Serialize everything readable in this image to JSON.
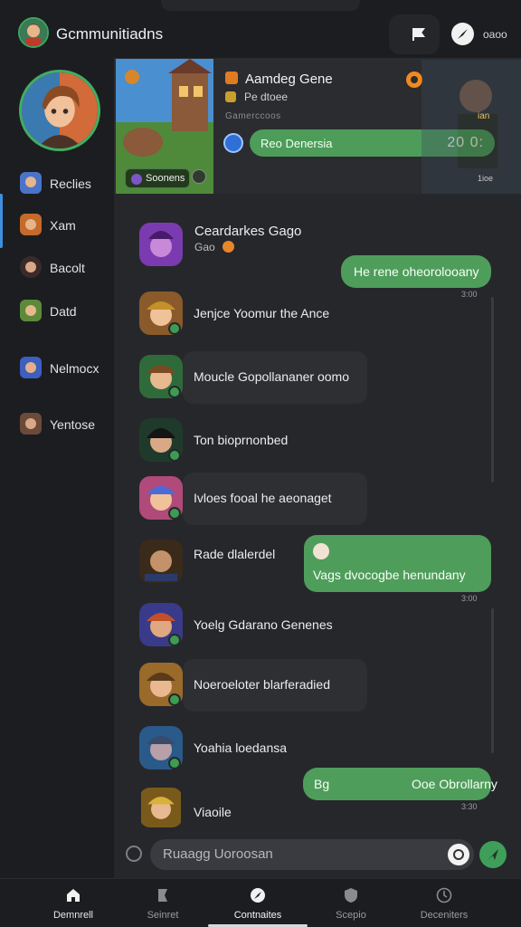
{
  "app": {
    "title": "Gcmmunitiadns"
  },
  "topbar": {
    "user_label": "oaoo"
  },
  "sidebar": {
    "items": [
      {
        "label": "Reclies",
        "color": "#4a73c9"
      },
      {
        "label": "Xam",
        "color": "#c46a2a"
      },
      {
        "label": "Bacolt",
        "color": "#3a2a2a"
      },
      {
        "label": "Datd",
        "color": "#5c8a3a"
      },
      {
        "label": "Nelmocx",
        "color": "#3d5fbf"
      },
      {
        "label": "Yentose",
        "color": "#6b4a3a"
      }
    ]
  },
  "header": {
    "banner_tag": "Soonens",
    "game_title": "Aamdeg Gene",
    "game_sub": "Pe dtoee",
    "game_meta": "Gamerccoos",
    "pill_text": "Reo Denersia",
    "pill_time": "20 0:",
    "ghost_label": "ian",
    "ghost_label2": "1ioe"
  },
  "chat": {
    "incoming": [
      {
        "text": "Jenjce Yoomur the Ance",
        "avatar": "#8a5a2a"
      },
      {
        "text": "Moucle Gopollananer oomo",
        "avatar": "#2f6b3a"
      },
      {
        "text": "Ton bioprnonbed",
        "avatar": "#2a2a2a"
      },
      {
        "text": "Ivloes fooal he aeonaget",
        "avatar": "#b04a7a"
      },
      {
        "text": "Rade dlalerdel",
        "avatar": "#3a2a1a"
      },
      {
        "text": "Yoelg Gdarano Genenes",
        "avatar": "#3a3a8a"
      },
      {
        "text": "Noeroeloter blarferadied",
        "avatar": "#9a6a2a"
      },
      {
        "text": "Yoahia loedansa",
        "avatar": "#2a5a8a"
      },
      {
        "text": "Viaoile",
        "avatar": "#7a5a1a"
      }
    ],
    "top_card": {
      "title": "Ceardarkes Gago",
      "sub": "Gao"
    },
    "outgoing": [
      {
        "text": "He rene oheorolooany",
        "time": "3:00"
      },
      {
        "text": "Vags dvocogbe henundany",
        "time": "3:00"
      },
      {
        "text_left": "Bg",
        "text_right": "Ooe Obrollarny",
        "time": "3:30"
      }
    ]
  },
  "input": {
    "placeholder": "Ruaagg Uoroosan"
  },
  "nav": {
    "items": [
      {
        "label": "Demnrell"
      },
      {
        "label": "Seinret"
      },
      {
        "label": "Contnaites"
      },
      {
        "label": "Scepio"
      },
      {
        "label": "Deceniters"
      }
    ],
    "active": "Contnaites"
  }
}
